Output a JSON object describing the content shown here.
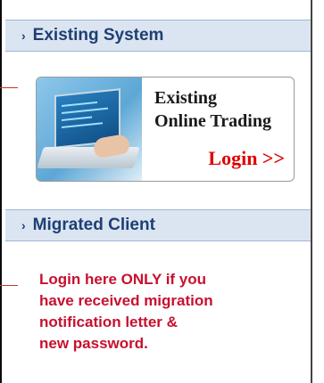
{
  "existing": {
    "header": "Existing System",
    "banner": {
      "line1": "Existing",
      "line2": "Online Trading",
      "cta": "Login >>"
    }
  },
  "migrated": {
    "header": "Migrated Client",
    "message_lines": [
      "Login here ONLY if you",
      "have received migration",
      "notification letter &",
      "new password."
    ]
  },
  "colors": {
    "header_bg": "#dbe5f1",
    "header_text": "#1f3f74",
    "cta": "#e00000",
    "message": "#c8102e"
  },
  "icons": {
    "section_chevron": "chevron-right-icon"
  }
}
